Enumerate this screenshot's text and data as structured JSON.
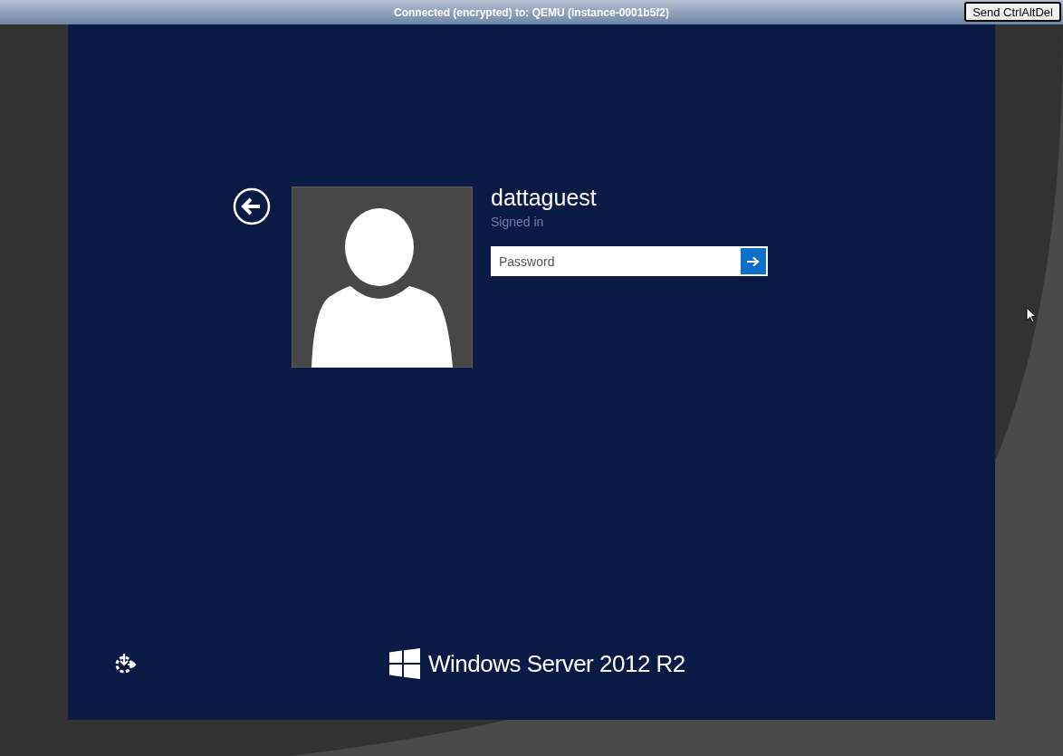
{
  "status_bar": {
    "title": "Connected (encrypted) to: QEMU (instance-0001b5f2)",
    "button": "Send CtrlAltDel"
  },
  "login": {
    "user_name": "dattaguest",
    "status": "Signed in",
    "password": {
      "placeholder": "Password"
    }
  },
  "brand": {
    "product": "Windows Server",
    "version": "2012 R2"
  }
}
